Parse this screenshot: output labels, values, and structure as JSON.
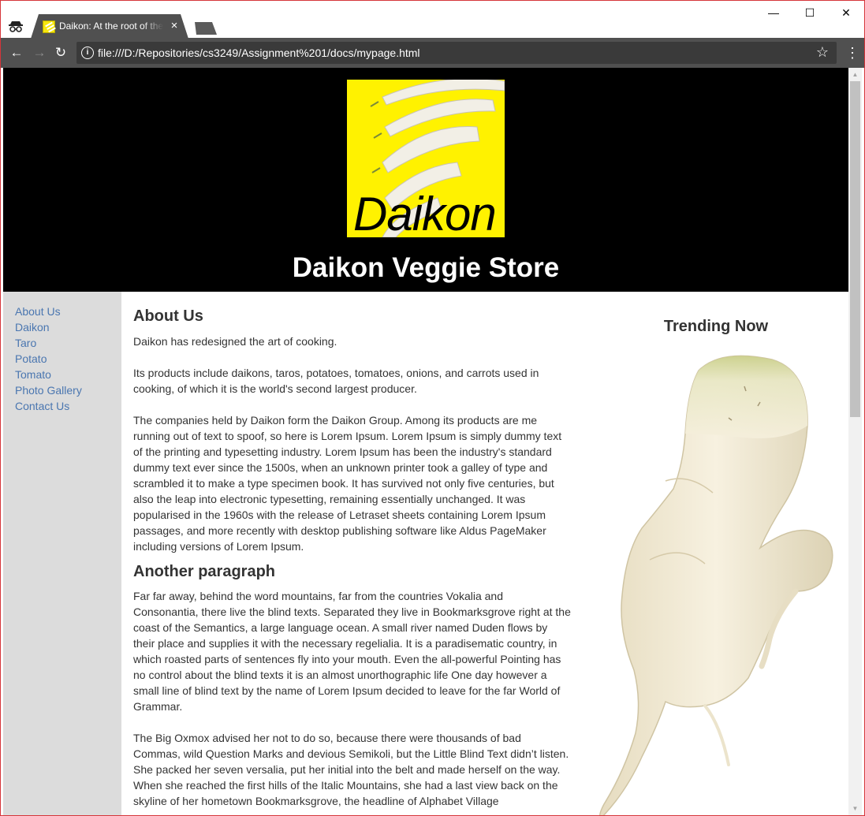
{
  "browser": {
    "tab_title": "Daikon: At the root of the matter",
    "tab_close": "×",
    "url": "file:///D:/Repositories/cs3249/Assignment%201/docs/mypage.html",
    "icons": {
      "incognito": "incognito-icon",
      "back": "←",
      "forward": "→",
      "reload": "↻",
      "info": "i",
      "star": "☆",
      "menu": "⋮",
      "minimize": "—",
      "maximize": "☐",
      "close": "✕"
    }
  },
  "header": {
    "logo_text": "Daikon",
    "site_title": "Daikon Veggie Store"
  },
  "nav": {
    "items": [
      {
        "label": "About Us"
      },
      {
        "label": "Daikon"
      },
      {
        "label": "Taro"
      },
      {
        "label": "Potato"
      },
      {
        "label": "Tomato"
      },
      {
        "label": "Photo Gallery"
      },
      {
        "label": "Contact Us"
      }
    ]
  },
  "main": {
    "heading": "About Us",
    "p1": "Daikon has redesigned the art of cooking.",
    "p2": "Its products include daikons, taros, potatoes, tomatoes, onions, and carrots used in cooking, of which it is the world's second largest producer.",
    "p3": "The companies held by Daikon form the Daikon Group. Among its products are me running out of text to spoof, so here is Lorem Ipsum. Lorem Ipsum is simply dummy text of the printing and typesetting industry. Lorem Ipsum has been the industry's standard dummy text ever since the 1500s, when an unknown printer took a galley of type and scrambled it to make a type specimen book. It has survived not only five centuries, but also the leap into electronic typesetting, remaining essentially unchanged. It was popularised in the 1960s with the release of Letraset sheets containing Lorem Ipsum passages, and more recently with desktop publishing software like Aldus PageMaker including versions of Lorem Ipsum.",
    "heading2": "Another paragraph",
    "p4": "Far far away, behind the word mountains, far from the countries Vokalia and Consonantia, there live the blind texts. Separated they live in Bookmarksgrove right at the coast of the Semantics, a large language ocean. A small river named Duden flows by their place and supplies it with the necessary regelialia. It is a paradisematic country, in which roasted parts of sentences fly into your mouth. Even the all-powerful Pointing has no control about the blind texts it is an almost unorthographic life One day however a small line of blind text by the name of Lorem Ipsum decided to leave for the far World of Grammar.",
    "p5": "The Big Oxmox advised her not to do so, because there were thousands of bad Commas, wild Question Marks and devious Semikoli, but the Little Blind Text didn’t listen. She packed her seven versalia, put her initial into the belt and made herself on the way. When she reached the first hills of the Italic Mountains, she had a last view back on the skyline of her hometown Bookmarksgrove, the headline of Alphabet Village"
  },
  "aside": {
    "title": "Trending Now"
  },
  "colors": {
    "header_bg": "#000000",
    "logo_bg": "#fff200",
    "sidebar_bg": "#dcdcdc",
    "link": "#4a76b0",
    "chrome_dark": "#505050",
    "body_text": "#333333"
  }
}
